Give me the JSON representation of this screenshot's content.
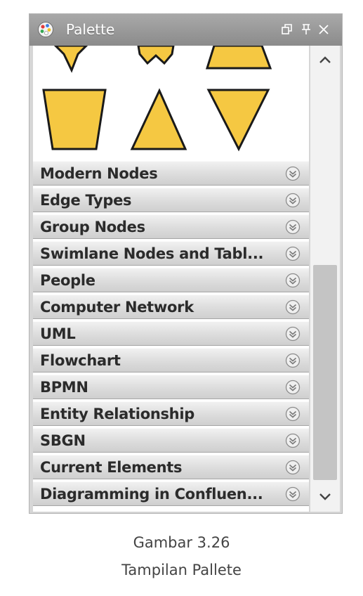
{
  "window": {
    "title": "Palette",
    "buttons": {
      "restore": "restore-icon",
      "pin": "pin-icon",
      "close": "close-icon"
    }
  },
  "colors": {
    "shape_fill": "#f5c842",
    "shape_stroke": "#1a1a1a",
    "title_bar": "#9a9a9a"
  },
  "sections": [
    {
      "label": "Modern Nodes"
    },
    {
      "label": "Edge Types"
    },
    {
      "label": "Group Nodes"
    },
    {
      "label": "Swimlane Nodes and Tabl..."
    },
    {
      "label": "People"
    },
    {
      "label": "Computer Network"
    },
    {
      "label": "UML"
    },
    {
      "label": "Flowchart"
    },
    {
      "label": "BPMN"
    },
    {
      "label": "Entity Relationship"
    },
    {
      "label": "SBGN"
    },
    {
      "label": "Current Elements"
    },
    {
      "label": "Diagramming in Confluen..."
    }
  ],
  "caption": {
    "line1": "Gambar 3.26",
    "line2": "Tampilan Pallete"
  }
}
